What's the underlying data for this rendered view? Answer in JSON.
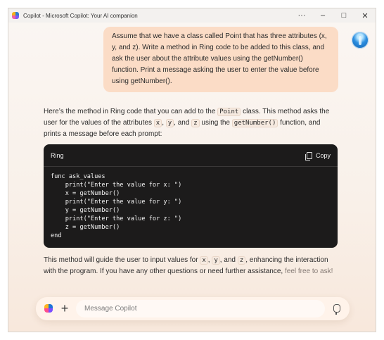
{
  "window": {
    "title": "Copilot - Microsoft Copilot: Your AI companion",
    "controls": [
      "···",
      "–",
      "□",
      "✕"
    ]
  },
  "user_message": "Assume that we have a class called Point that has three attributes (x, y, and z). Write a method in Ring code to be added to this class, and ask the user about the attribute values using the getNumber() function. Print a message asking the user to enter the value before using getNumber().",
  "response": {
    "intro_1": "Here’s the method in Ring code that you can add to the",
    "chip_point": "Point",
    "intro_2": "class. This method asks the user for the values of the attributes",
    "chip_x": "x",
    "comma1": ",",
    "chip_y": "y",
    "and1": ", and",
    "chip_z": "z",
    "intro_3": "using the",
    "chip_getnumber": "getNumber()",
    "intro_4": "function, and prints a message before each prompt:",
    "code": {
      "language": "Ring",
      "copy_label": "Copy",
      "source": "func ask_values\n    print(\"Enter the value for x: \")\n    x = getNumber()\n    print(\"Enter the value for y: \")\n    y = getNumber()\n    print(\"Enter the value for z: \")\n    z = getNumber()\nend"
    },
    "outro_1": "This method will guide the user to input values for",
    "outro_chip_x": "x",
    "outro_comma": ",",
    "outro_chip_y": "y",
    "outro_and": ", and",
    "outro_chip_z": "z",
    "outro_2": ", enhancing the interaction with the program. If you have any other questions or need further assistance,",
    "outro_3": "feel free to ask!"
  },
  "composer": {
    "placeholder": "Message Copilot",
    "value": ""
  },
  "icons": {
    "app": "copilot-logo-icon",
    "avatar": "user-avatar-icon",
    "plus": "plus-icon",
    "mic": "microphone-icon",
    "copy": "copy-icon"
  }
}
